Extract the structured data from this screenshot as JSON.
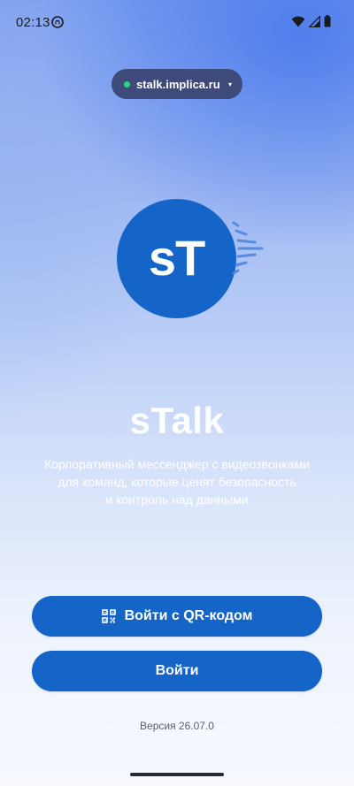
{
  "status_bar": {
    "time": "02:13",
    "icons": [
      "app-notification-icon",
      "wifi-icon",
      "cell-signal-icon",
      "battery-icon"
    ]
  },
  "server": {
    "address": "stalk.implica.ru",
    "status_color": "#2fd27a",
    "caret": "▾"
  },
  "logo": {
    "mark": "sT",
    "color": "#1565c8"
  },
  "app": {
    "title": "sTalk",
    "subtitle_lines": [
      "Корпоративный мессенджер с видеозвонками",
      "для команд, которые ценят безопасность",
      "и контроль над данными"
    ]
  },
  "actions": {
    "qr_login_label": "Войти с QR-кодом",
    "login_label": "Войти",
    "button_color": "#1565c8"
  },
  "footer": {
    "version": "Версия 26.07.0"
  }
}
